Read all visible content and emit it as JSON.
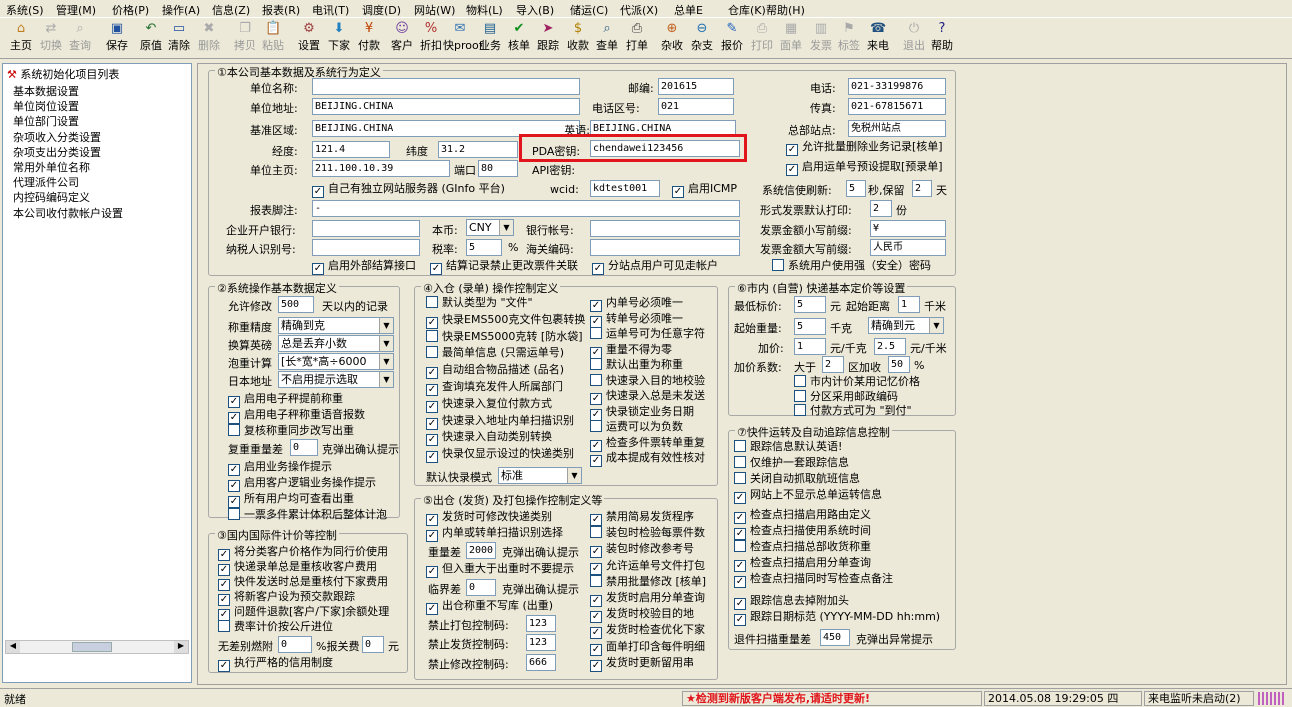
{
  "menu": [
    "系统(S)",
    "管理(M)",
    "价格(P)",
    "操作(A)",
    "信息(Z)",
    "报表(R)",
    "电讯(T)",
    "调度(D)",
    "网站(W)",
    "物料(L)",
    "导入(B)",
    "储运(C)",
    "代派(X)",
    "总单E",
    "仓库(K)",
    "帮助(H)"
  ],
  "toolbar": [
    {
      "icon": "home-icon",
      "label": "主页",
      "enabled": true
    },
    {
      "icon": "switch-icon",
      "label": "切换",
      "enabled": false
    },
    {
      "icon": "query-icon",
      "label": "查询",
      "enabled": false
    },
    {
      "icon": "save-icon",
      "label": "保存",
      "enabled": true
    },
    {
      "icon": "original-icon",
      "label": "原值",
      "enabled": true
    },
    {
      "icon": "clear-icon",
      "label": "清除",
      "enabled": true
    },
    {
      "icon": "delete-icon",
      "label": "删除",
      "enabled": false
    },
    {
      "icon": "copy-icon",
      "label": "拷贝",
      "enabled": false
    },
    {
      "icon": "paste-icon",
      "label": "粘贴",
      "enabled": false
    },
    {
      "icon": "settings-icon",
      "label": "设置",
      "enabled": true
    },
    {
      "icon": "order-icon",
      "label": "下家",
      "enabled": true
    },
    {
      "icon": "payment-icon",
      "label": "付款",
      "enabled": true
    },
    {
      "icon": "customer-icon",
      "label": "客户",
      "enabled": true
    },
    {
      "icon": "discount-icon",
      "label": "折扣",
      "enabled": true
    },
    {
      "icon": "express-icon",
      "label": "快proof",
      "enabled": true
    },
    {
      "icon": "business-icon",
      "label": "业务",
      "enabled": true
    },
    {
      "icon": "verify-icon",
      "label": "核单",
      "enabled": true
    },
    {
      "icon": "track-icon",
      "label": "跟踪",
      "enabled": true
    },
    {
      "icon": "receive-icon",
      "label": "收款",
      "enabled": true
    },
    {
      "icon": "lookup-icon",
      "label": "查单",
      "enabled": true
    },
    {
      "icon": "print-icon",
      "label": "打单",
      "enabled": true
    },
    {
      "icon": "misc-receive-icon",
      "label": "杂收",
      "enabled": true
    },
    {
      "icon": "misc-send-icon",
      "label": "杂支",
      "enabled": true
    },
    {
      "icon": "quote-icon",
      "label": "报价",
      "enabled": true
    },
    {
      "icon": "print2-icon",
      "label": "打印",
      "enabled": false
    },
    {
      "icon": "face-icon",
      "label": "面单",
      "enabled": false
    },
    {
      "icon": "invoice-icon",
      "label": "发票",
      "enabled": false
    },
    {
      "icon": "tag-icon",
      "label": "标签",
      "enabled": false
    },
    {
      "icon": "phone-icon",
      "label": "来电",
      "enabled": true
    },
    {
      "icon": "exit-icon",
      "label": "退出",
      "enabled": false
    },
    {
      "icon": "help-icon",
      "label": "帮助",
      "enabled": true
    }
  ],
  "left": {
    "title": "系统初始化项目列表",
    "items": [
      "基本数据设置",
      "单位岗位设置",
      "单位部门设置",
      "杂项收入分类设置",
      "杂项支出分类设置",
      "常用外单位名称",
      "代理派件公司",
      "内控码编码定义",
      "本公司收付款帐户设置"
    ]
  },
  "g1": {
    "title": "①本公司基本数据及系统行为定义",
    "name_label": "单位名称:",
    "name_val": "",
    "zip_label": "邮编:",
    "zip_val": "201615",
    "tel_label": "电话:",
    "tel_val": "021-33199876",
    "addr_label": "单位地址:",
    "addr_val": "BEIJING.CHINA",
    "area_label": "电话区号:",
    "area_val": "021",
    "fax_label": "传真:",
    "fax_val": "021-67815671",
    "region_label": "基准区域:",
    "region_val": "BEIJING.CHINA",
    "en_label": "英语:",
    "en_val": "BEIJING.CHINA",
    "hq_label": "总部站点:",
    "hq_val": "免税州站点",
    "lng_label": "经度:",
    "lng_val": "121.4",
    "lat_label": "纬度",
    "lat_val": "31.2",
    "pda_label": "PDA密钥:",
    "pda_val": "chendawei123456",
    "allow_batch": "允许批量删除业务记录[核单]",
    "host_label": "单位主页:",
    "host_val": "211.100.10.39",
    "port_label": "端口",
    "port_val": "80",
    "api_label": "API密钥:",
    "api_val": "",
    "preset": "启用运单号预设提取[预录单]",
    "own_server": "自己有独立网站服务器 (GInfo 平台)",
    "wcid_label": "wcid:",
    "wcid_val": "kdtest001",
    "icmp": "启用ICMP",
    "refresh_label": "系统信使刷新:",
    "refresh_val": "5",
    "refresh_unit": "秒,保留",
    "keep_val": "2",
    "keep_unit": "天",
    "invprint_label": "形式发票默认打印:",
    "invprint_val": "2",
    "invprint_unit": "份",
    "footer_label": "报表脚注:",
    "footer_val": "-",
    "bank_label": "企业开户银行:",
    "bank_val": "",
    "cur_label": "本币:",
    "cur_val": "CNY",
    "acct_label": "银行帐号:",
    "acct_val": "",
    "small_prefix_label": "发票金额小写前缀:",
    "small_prefix_val": "¥",
    "taxid_label": "纳税人识别号:",
    "taxid_val": "",
    "rate_label": "税率:",
    "rate_val": "5",
    "rate_unit": "%",
    "customs_label": "海关编码:",
    "customs_val": "",
    "big_prefix_label": "发票金额大写前缀:",
    "big_prefix_val": "人民币",
    "ext_settle": "启用外部结算接口",
    "settle_lock": "结算记录禁止更改票件关联",
    "branch_visible": "分站点用户可见走帐户",
    "strong_pwd": "系统用户使用强（安全）密码"
  },
  "g2": {
    "title": "②系统操作基本数据定义",
    "allow_mod_label": "允许修改",
    "allow_mod_val": "500",
    "allow_mod_unit": "天以内的记录",
    "weight_prec_label": "称重精度",
    "weight_prec_val": "精确到克",
    "round_label": "换算英磅",
    "round_val": "总是丢弃小数",
    "vol_label": "泡重计算",
    "vol_val": "[长*宽*高÷6000",
    "jp_addr_label": "日本地址",
    "jp_addr_val": "不启用提示选取",
    "c1": "启用电子秤提前称重",
    "c2": "启用电子秤称重语音报数",
    "c3": "复核称重同步改写出重",
    "reweigh_label": "复重重量差",
    "reweigh_val": "0",
    "reweigh_unit": "克弹出确认提示",
    "c4": "启用业务操作提示",
    "c5": "启用客户逻辑业务操作提示",
    "c6": "所有用户均可查看出重",
    "c7": "一票多件累计体积后整体计泡"
  },
  "g3": {
    "title": "③国内国际件计价等控制",
    "c1": "将分类客户价格作为同行价使用",
    "c2": "快递录单总是重核收客户费用",
    "c3": "快件发送时总是重核付下家费用",
    "c4": "将新客户设为预交款跟踪",
    "c5": "问题件退款[客户/下家]余额处理",
    "c6": "费率计价按公斤进位",
    "nodiff_label": "无差别燃附",
    "nodiff_val": "0",
    "nodiff_unit": "%报关费",
    "fee_val": "0",
    "fee_unit": "元",
    "c7": "执行严格的信用制度"
  },
  "g4": {
    "title": "④入仓 (录单) 操作控制定义",
    "l1": "默认类型为 \"文件\"",
    "l2": "快录EMS500克文件包裹转换",
    "l3": "快录EMS5000克转 [防水袋]",
    "l4": "最简单信息 (只需运单号)",
    "l5": "自动组合物品描述 (品名)",
    "l6": "查询填充发件人所属部门",
    "l7": "快速录入复位付款方式",
    "l8": "快速录入地址内单扫描识别",
    "l9": "快速录入自动类别转换",
    "l10": "快录仅显示设过的快递类别",
    "r1": "内单号必须唯一",
    "r2": "转单号必须唯一",
    "r3": "运单号可为任意字符",
    "r4": "重量不得为零",
    "r5": "默认出重为称重",
    "r6": "快速录入目的地校验",
    "r7": "快速录入总是未发送",
    "r8": "快录锁定业务日期",
    "r9": "运费可以为负数",
    "r10": "检查多件票转单重复",
    "r11": "成本提成有效性核对",
    "mode_label": "默认快录模式",
    "mode_val": "标准"
  },
  "g5": {
    "title": "⑤出仓 (发货) 及打包操作控制定义等",
    "l1": "发货时可修改快递类别",
    "l2": "内单或转单扫描识别选择",
    "w1_label": "重量差",
    "w1_val": "2000",
    "w1_unit": "克弹出确认提示",
    "l3": "但入重大于出重时不要提示",
    "w2_label": "临界差",
    "w2_val": "0",
    "w2_unit": "克弹出确认提示",
    "l4": "出仓称重不写库 (出重)",
    "p1_label": "禁止打包控制码:",
    "p1_val": "123",
    "p2_label": "禁止发货控制码:",
    "p2_val": "123",
    "p3_label": "禁止修改控制码:",
    "p3_val": "666",
    "r1": "禁用简易发货程序",
    "r2": "装包时检验每票件数",
    "r3": "装包时修改参考号",
    "r4": "允许运单号文件打包",
    "r5": "禁用批量修改 [核单]",
    "r6": "发货时启用分单查询",
    "r7": "发货时校验目的地",
    "r8": "发货时检查优化下家",
    "r9": "面单打印含每件明细",
    "r10": "发货时更新留用串"
  },
  "g6": {
    "title": "⑥市内 (自营) 快递基本定价等设置",
    "min_label": "最低标价:",
    "min_val": "5",
    "min_unit": "元",
    "start_label": "起始距离",
    "start_val": "1",
    "start_unit": "千米",
    "sw_label": "起始重量:",
    "sw_val": "5",
    "sw_unit": "千克",
    "prec_val": "精确到元",
    "add_label": "加价:",
    "add_val": "1",
    "add_unit": "元/千克",
    "add2_val": "2.5",
    "add2_unit": "元/千米",
    "factor_label": "加价系数:",
    "factor_pre": "大于",
    "factor_val": "2",
    "factor_mid": "区加收",
    "factor_pct": "50",
    "factor_unit": "%",
    "c1": "市内计价某用记忆价格",
    "c2": "分区采用邮政编码",
    "c3": "付款方式可为 \"到付\""
  },
  "g7": {
    "title": "⑦快件运转及自动追踪信息控制",
    "c1": "跟踪信息默认英语!",
    "c2": "仅维护一套跟踪信息",
    "c3": "关闭自动抓取航班信息",
    "c4": "网站上不显示总单运转信息",
    "c5": "检查点扫描启用路由定义",
    "c6": "检查点扫描使用系统时间",
    "c7": "检查点扫描总部收货称重",
    "c8": "检查点扫描启用分单查询",
    "c9": "检查点扫描同时写检查点备注",
    "c10": "跟踪信息去掉附加头",
    "c11": "跟踪日期标范 (YYYY-MM-DD hh:mm)",
    "ret_label": "退件扫描重量差",
    "ret_val": "450",
    "ret_unit": "克弹出异常提示"
  },
  "status": {
    "ready": "就绪",
    "alert": "★检测到新版客户端发布,请适时更新!",
    "datetime": "2014.05.08 19:29:05 四",
    "phone": "来电监听未启动(2)"
  },
  "colors": {
    "highlight_box": "#e0161c",
    "alert_text": "#e0161c"
  }
}
